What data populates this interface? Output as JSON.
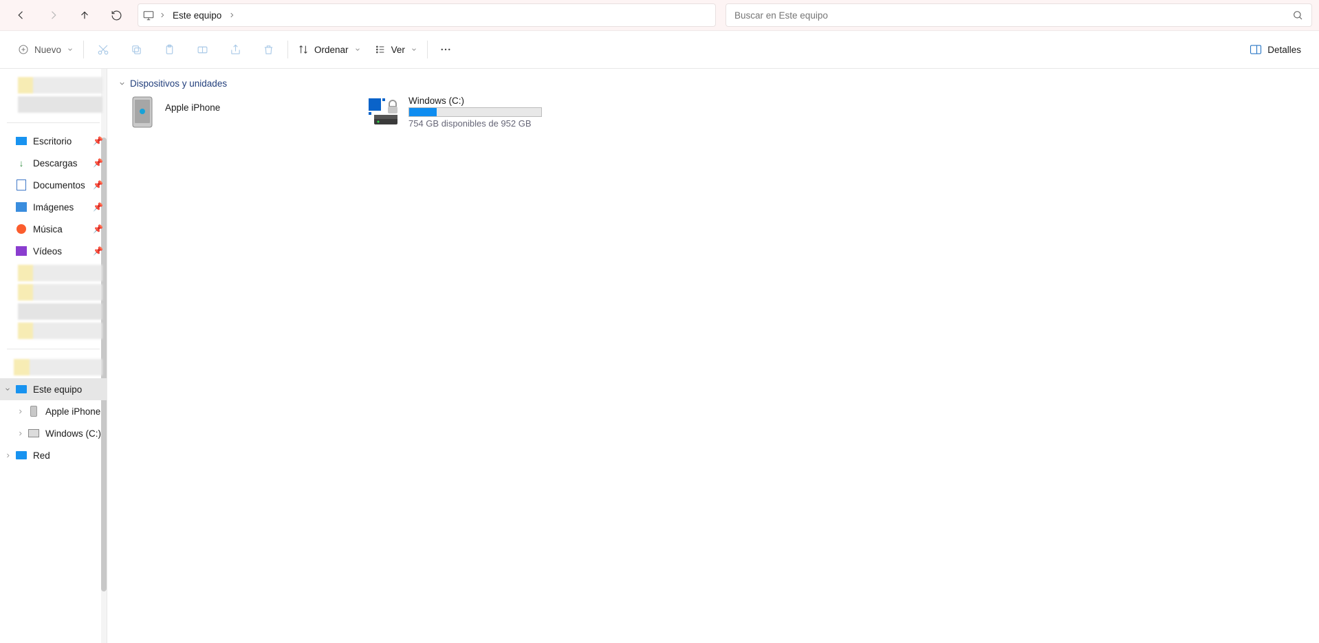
{
  "nav": {
    "location": "Este equipo"
  },
  "search": {
    "placeholder": "Buscar en Este equipo"
  },
  "toolbar": {
    "new": "Nuevo",
    "sort": "Ordenar",
    "view": "Ver",
    "details": "Detalles"
  },
  "sidebar": {
    "quick": [
      {
        "id": "escritorio",
        "label": "Escritorio",
        "pinned": true
      },
      {
        "id": "descargas",
        "label": "Descargas",
        "pinned": true
      },
      {
        "id": "documentos",
        "label": "Documentos",
        "pinned": true
      },
      {
        "id": "imagenes",
        "label": "Imágenes",
        "pinned": true
      },
      {
        "id": "musica",
        "label": "Música",
        "pinned": true
      },
      {
        "id": "videos",
        "label": "Vídeos",
        "pinned": true
      }
    ],
    "thispc": {
      "label": "Este equipo",
      "children": [
        {
          "id": "iphone",
          "label": "Apple iPhone"
        },
        {
          "id": "cdrive",
          "label": "Windows (C:)"
        }
      ]
    },
    "network": {
      "label": "Red"
    }
  },
  "main": {
    "group_header": "Dispositivos y unidades",
    "items": [
      {
        "kind": "device",
        "name": "Apple iPhone"
      },
      {
        "kind": "drive",
        "name": "Windows (C:)",
        "free_text": "754 GB disponibles de 952 GB",
        "fill_percent": 21
      }
    ]
  }
}
